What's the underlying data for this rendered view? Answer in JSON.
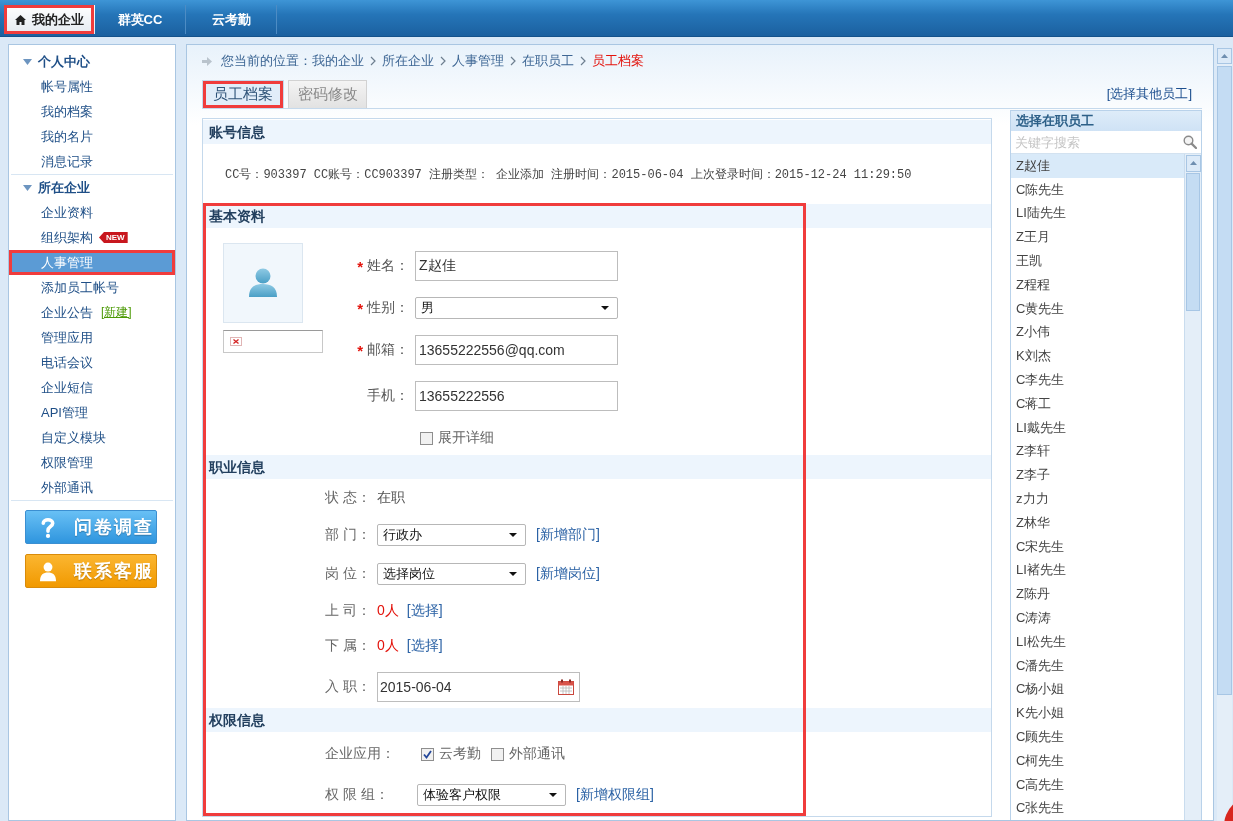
{
  "top_nav": {
    "tabs": [
      {
        "label": "我的企业",
        "icon": true,
        "selected": true,
        "highlighted": true
      },
      {
        "label": "群英CC",
        "icon": false,
        "selected": false,
        "highlighted": false
      },
      {
        "label": "云考勤",
        "icon": false,
        "selected": false,
        "highlighted": false
      }
    ]
  },
  "sidebar": {
    "groups": [
      {
        "label": "个人中心",
        "expanded": true,
        "items": [
          {
            "label": "帐号属性",
            "selected": false,
            "highlighted": false
          },
          {
            "label": "我的档案",
            "selected": false,
            "highlighted": false
          },
          {
            "label": "我的名片",
            "selected": false,
            "highlighted": false
          },
          {
            "label": "消息记录",
            "selected": false,
            "highlighted": false
          }
        ]
      },
      {
        "label": "所在企业",
        "expanded": true,
        "items": [
          {
            "label": "企业资料",
            "selected": false,
            "highlighted": false
          },
          {
            "label": "组织架构",
            "badge": "NEW",
            "selected": false,
            "highlighted": false
          },
          {
            "label": "人事管理",
            "selected": true,
            "highlighted": true
          },
          {
            "label": "添加员工帐号",
            "selected": false,
            "highlighted": false
          },
          {
            "label": "企业公告",
            "link": "[新建]",
            "selected": false,
            "highlighted": false
          },
          {
            "label": "管理应用",
            "selected": false,
            "highlighted": false
          },
          {
            "label": "电话会议",
            "selected": false,
            "highlighted": false
          },
          {
            "label": "企业短信",
            "selected": false,
            "highlighted": false
          },
          {
            "label": "API管理",
            "selected": false,
            "highlighted": false
          },
          {
            "label": "自定义模块",
            "selected": false,
            "highlighted": false
          },
          {
            "label": "权限管理",
            "selected": false,
            "highlighted": false
          },
          {
            "label": "外部通讯",
            "selected": false,
            "highlighted": false
          }
        ]
      }
    ],
    "buttons": [
      {
        "label": "问卷调查",
        "kind": "survey"
      },
      {
        "label": "联系客服",
        "kind": "support"
      }
    ]
  },
  "breadcrumb": {
    "prefix": "您当前的位置：",
    "items": [
      {
        "label": "我的企业",
        "current": false
      },
      {
        "label": "所在企业",
        "current": false
      },
      {
        "label": "人事管理",
        "current": false
      },
      {
        "label": "在职员工",
        "current": false
      },
      {
        "label": "员工档案",
        "current": true
      }
    ]
  },
  "tabs": [
    {
      "label": "员工档案",
      "selected": true,
      "highlighted": true
    },
    {
      "label": "密码修改",
      "selected": false,
      "highlighted": false
    }
  ],
  "other_employee_link": "[选择其他员工]",
  "account_info": {
    "title": "账号信息",
    "text": "CC号：903397 CC账号：CC903397 注册类型： 企业添加 注册时间：2015-06-04 上次登录时间：2015-12-24 11:29:50"
  },
  "highlight_frame": true,
  "basic_info": {
    "title": "基本资料",
    "required_mark": "*",
    "fields": [
      {
        "label": "姓名：",
        "required": true,
        "kind": "text",
        "value": "Z赵佳"
      },
      {
        "label": "性别：",
        "required": true,
        "kind": "select",
        "value": "男"
      },
      {
        "label": "邮箱：",
        "required": true,
        "kind": "text",
        "value": "13655222556@qq.com"
      },
      {
        "label": "手机：",
        "required": false,
        "kind": "text",
        "value": "13655222556"
      }
    ],
    "expand_option": {
      "label": "展开详细",
      "checked": false
    }
  },
  "job_info": {
    "title": "职业信息",
    "rows": [
      {
        "kind": "text",
        "label": "状 态：",
        "value": "在职"
      },
      {
        "kind": "select",
        "label": "部 门：",
        "value": "行政办",
        "link": "[新增部门]"
      },
      {
        "kind": "select",
        "label": "岗 位：",
        "value": "选择岗位",
        "link": "[新增岗位]"
      },
      {
        "kind": "count",
        "label": "上 司：",
        "value": "0人",
        "link": "[选择]"
      },
      {
        "kind": "count",
        "label": "下 属：",
        "value": "0人",
        "link": "[选择]"
      },
      {
        "kind": "date",
        "label": "入 职：",
        "value": "2015-06-04"
      }
    ]
  },
  "permissions": {
    "title": "权限信息",
    "apps": {
      "label": "企业应用：",
      "options": [
        {
          "label": "云考勤",
          "checked": true
        },
        {
          "label": "外部通讯",
          "checked": false
        }
      ]
    },
    "group": {
      "label": "权 限 组：",
      "value": "体验客户权限",
      "link": "[新增权限组]"
    }
  },
  "employee_picker": {
    "title": "选择在职员工",
    "search_placeholder": "关键字搜索",
    "employees": [
      {
        "name": "Z赵佳",
        "selected": true
      },
      {
        "name": "C陈先生",
        "selected": false
      },
      {
        "name": "LI陆先生",
        "selected": false
      },
      {
        "name": "Z王月",
        "selected": false
      },
      {
        "name": "王凯",
        "selected": false
      },
      {
        "name": "Z程程",
        "selected": false
      },
      {
        "name": "C黄先生",
        "selected": false
      },
      {
        "name": "Z小伟",
        "selected": false
      },
      {
        "name": "K刘杰",
        "selected": false
      },
      {
        "name": "C李先生",
        "selected": false
      },
      {
        "name": "C蒋工",
        "selected": false
      },
      {
        "name": "LI戴先生",
        "selected": false
      },
      {
        "name": "Z李轩",
        "selected": false
      },
      {
        "name": "Z李子",
        "selected": false
      },
      {
        "name": "z力力",
        "selected": false
      },
      {
        "name": "Z林华",
        "selected": false
      },
      {
        "name": "C宋先生",
        "selected": false
      },
      {
        "name": "LI褚先生",
        "selected": false
      },
      {
        "name": "Z陈丹",
        "selected": false
      },
      {
        "name": "C涛涛",
        "selected": false
      },
      {
        "name": "LI松先生",
        "selected": false
      },
      {
        "name": "C潘先生",
        "selected": false
      },
      {
        "name": "C杨小姐",
        "selected": false
      },
      {
        "name": "K先小姐",
        "selected": false
      },
      {
        "name": "C顾先生",
        "selected": false
      },
      {
        "name": "C柯先生",
        "selected": false
      },
      {
        "name": "C高先生",
        "selected": false
      },
      {
        "name": "C张先生",
        "selected": false
      }
    ]
  }
}
